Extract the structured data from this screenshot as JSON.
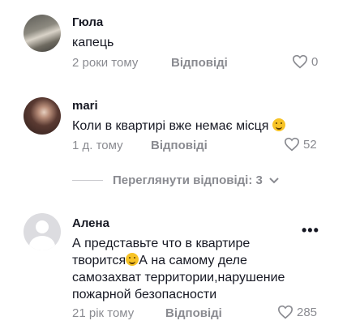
{
  "comments": [
    {
      "username": "Гюла",
      "text_lines": [
        "капець"
      ],
      "time": "2 роки тому",
      "reply_label": "Відповіді",
      "likes": "0"
    },
    {
      "username": "mari",
      "text_lines": [
        "Коли в квартирі вже немає місця"
      ],
      "time": "1 д. тому",
      "reply_label": "Відповіді",
      "likes": "52"
    },
    {
      "username": "Алена",
      "text_lines": [
        "А представьте что в квартире",
        "творится",
        "А на самому деле",
        "самозахват территории,нарушение",
        "пожарной безопасности"
      ],
      "time": "21 рік тому",
      "reply_label": "Відповіді",
      "likes": "285"
    }
  ],
  "view_replies": "Переглянути відповіді: 3",
  "more_label": "•••",
  "icons": {
    "like": "heart-outline-icon",
    "expand": "chevron-down-icon",
    "more": "more-horizontal-icon",
    "emoji": "smiling-face-emoji-icon"
  },
  "colors": {
    "text_primary": "#161823",
    "text_secondary": "#8a8b91"
  }
}
